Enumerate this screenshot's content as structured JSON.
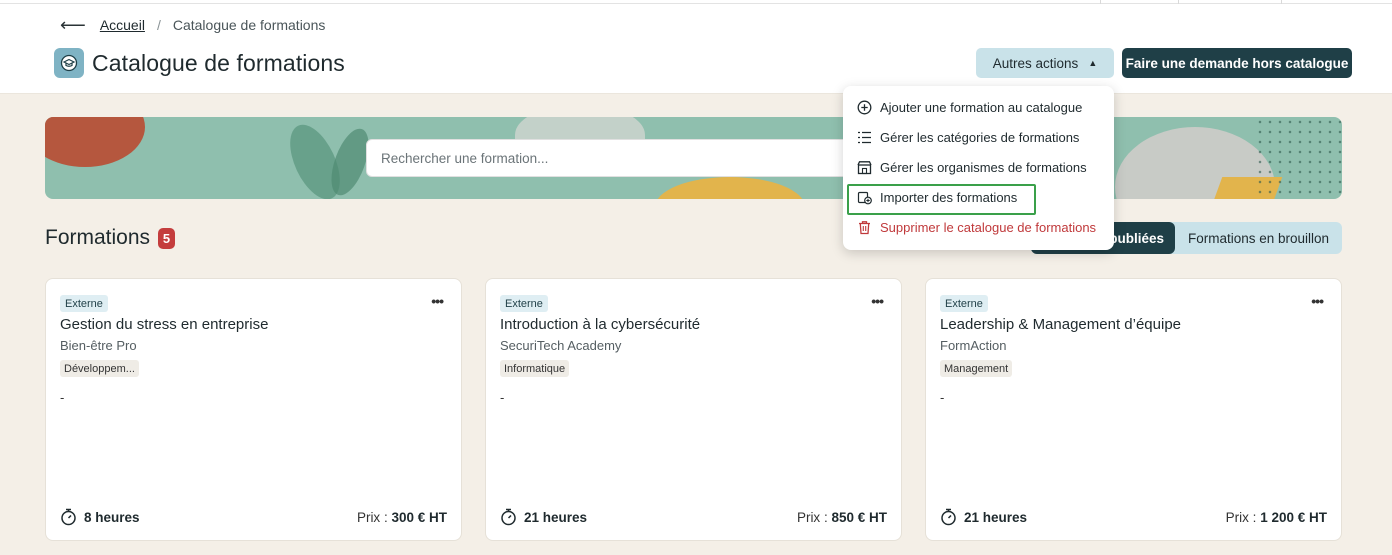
{
  "breadcrumb": {
    "back_icon": "arrow-left-icon",
    "home": "Accueil",
    "separator": "/",
    "current": "Catalogue de formations"
  },
  "header": {
    "title": "Catalogue de formations",
    "title_icon": "graduation-cap-icon",
    "other_actions": "Autres actions",
    "request_button": "Faire une demande hors catalogue"
  },
  "search": {
    "placeholder": "Rechercher une formation..."
  },
  "section": {
    "title": "Formations",
    "count": "5"
  },
  "toggle": {
    "published": "Formations publiées",
    "draft": "Formations en brouillon",
    "published_visible": "publiées"
  },
  "menu": {
    "items": [
      {
        "label": "Ajouter une formation au catalogue",
        "icon": "plus-circle-icon"
      },
      {
        "label": "Gérer les catégories de formations",
        "icon": "list-icon"
      },
      {
        "label": "Gérer les organismes de formations",
        "icon": "building-icon"
      },
      {
        "label": "Importer des formations",
        "icon": "import-icon"
      },
      {
        "label": "Supprimer le catalogue de formations",
        "icon": "trash-icon"
      }
    ]
  },
  "cards": [
    {
      "tag": "Externe",
      "name": "Gestion du stress en entreprise",
      "org": "Bien-être Pro",
      "category": "Développem...",
      "description": "-",
      "duration": "8 heures",
      "price_label": "Prix :",
      "price": "300 € HT"
    },
    {
      "tag": "Externe",
      "name": "Introduction à la cybersécurité",
      "org": "SecuriTech Academy",
      "category": "Informatique",
      "description": "-",
      "duration": "21 heures",
      "price_label": "Prix :",
      "price": "850 € HT"
    },
    {
      "tag": "Externe",
      "name": "Leadership & Management d’équipe",
      "org": "FormAction",
      "category": "Management",
      "description": "-",
      "duration": "21 heures",
      "price_label": "Prix :",
      "price": "1 200 € HT"
    }
  ],
  "colors": {
    "primary_dark": "#1f3f47",
    "accent_light": "#c9e2e9",
    "badge_red": "#c43d3d",
    "danger": "#c0393b",
    "highlight_green": "#3aa04a",
    "background": "#f4efe7"
  }
}
